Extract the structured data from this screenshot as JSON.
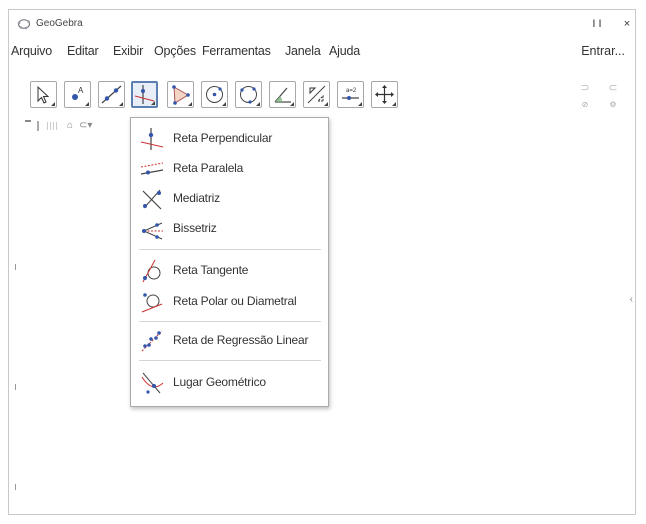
{
  "window": {
    "title": "GeoGebra",
    "minimize_glyph": "I I",
    "close_glyph": "×"
  },
  "menubar": {
    "items": [
      "Arquivo",
      "Editar",
      "Exibir",
      "Opções",
      "Ferramentas",
      "Janela",
      "Ajuda"
    ],
    "sign_in": "Entrar..."
  },
  "toolbar": {
    "tools": [
      {
        "icon": "move-icon"
      },
      {
        "icon": "point-icon"
      },
      {
        "icon": "line-icon"
      },
      {
        "icon": "perpendicular-line-icon",
        "active": true
      },
      {
        "icon": "polygon-icon"
      },
      {
        "icon": "circle-center-point-icon"
      },
      {
        "icon": "circle-three-points-icon"
      },
      {
        "icon": "angle-icon"
      },
      {
        "icon": "reflect-icon"
      },
      {
        "icon": "slider-icon"
      },
      {
        "icon": "move-graphics-view-icon"
      }
    ],
    "undo_glyph": "⊃",
    "redo_glyph": "⊂"
  },
  "dropdown": {
    "items": [
      {
        "label": "Reta Perpendicular",
        "icon": "perpendicular-line-icon"
      },
      {
        "label": "Reta Paralela",
        "icon": "parallel-line-icon"
      },
      {
        "label": "Mediatriz",
        "icon": "perpendicular-bisector-icon"
      },
      {
        "label": "Bissetriz",
        "icon": "angle-bisector-icon"
      },
      {
        "label": "Reta Tangente",
        "icon": "tangent-line-icon"
      },
      {
        "label": "Reta Polar ou Diametral",
        "icon": "polar-line-icon"
      },
      {
        "label": "Reta de Regressão Linear",
        "icon": "best-fit-line-icon"
      },
      {
        "label": "Lugar Geométrico",
        "icon": "locus-icon"
      }
    ]
  },
  "colors": {
    "accent": "#5a7fb0",
    "point_blue": "#3355aa",
    "line_red": "#cc3333"
  }
}
